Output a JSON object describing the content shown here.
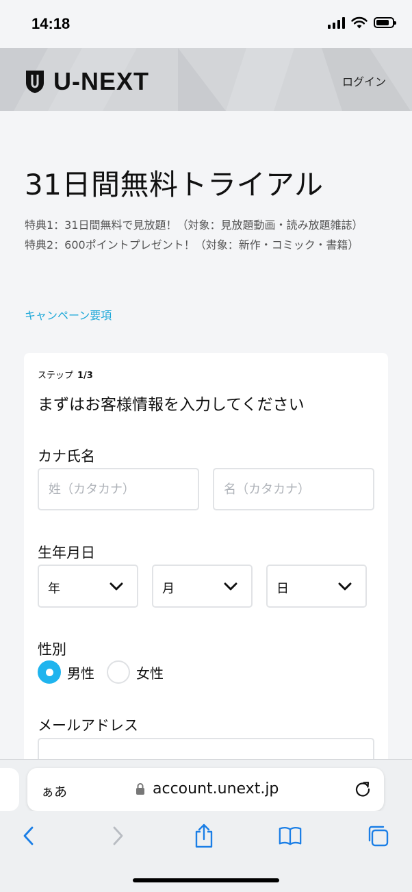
{
  "status_bar": {
    "time": "14:18"
  },
  "header": {
    "logo_text": "U-NEXT",
    "login_label": "ログイン"
  },
  "hero": {
    "title": "31日間無料トライアル",
    "benefits": [
      "特典1：31日間無料で見放題！（対象：見放題動画・読み放題雑誌）",
      "特典2：600ポイントプレゼント！（対象：新作・コミック・書籍）"
    ],
    "campaign_link": "キャンペーン要項"
  },
  "form": {
    "step_label": "ステップ",
    "step_number": "1/3",
    "heading": "まずはお客様情報を入力してください",
    "kana_name": {
      "label": "カナ氏名",
      "last_placeholder": "姓（カタカナ）",
      "first_placeholder": "名（カタカナ）"
    },
    "birthdate": {
      "label": "生年月日",
      "year": "年",
      "month": "月",
      "day": "日"
    },
    "gender": {
      "label": "性別",
      "options": [
        {
          "label": "男性",
          "selected": true
        },
        {
          "label": "女性",
          "selected": false
        }
      ]
    },
    "email": {
      "label": "メールアドレス",
      "value": ""
    }
  },
  "browser": {
    "aa_label": "ぁあ",
    "url": "account.unext.jp"
  },
  "colors": {
    "accent": "#1fb4ee",
    "link": "#1ea8d8",
    "header_bg": "#d3d5d8",
    "toolbar_icon": "#1a7ee6"
  }
}
